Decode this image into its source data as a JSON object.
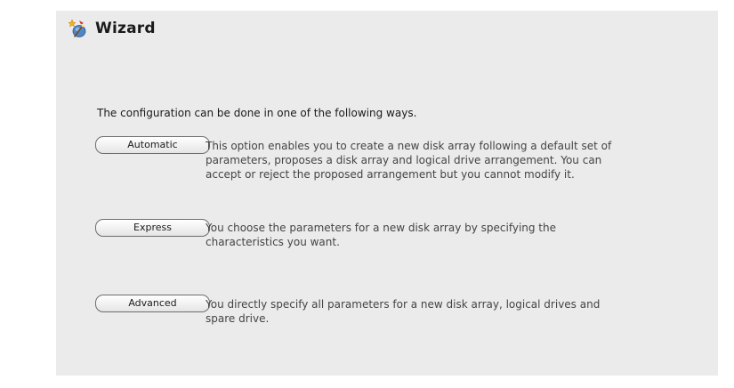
{
  "header": {
    "title": "Wizard",
    "icon": "wizard-icon"
  },
  "intro_text": "The configuration can be done in one of the following ways.",
  "options": [
    {
      "label": "Automatic",
      "description": "This option enables you to create a new disk array following a default set of parameters, proposes a disk array and logical drive arrangement. You can accept or reject the proposed arrangement but you cannot modify it."
    },
    {
      "label": "Express",
      "description": "You choose the parameters for a new disk array by specifying the characteristics you want."
    },
    {
      "label": "Advanced",
      "description": "You directly specify all parameters for a new disk array, logical drives and spare drive."
    }
  ],
  "colors": {
    "panel_background": "#ebebeb",
    "text": "#1a1a1a",
    "description_text": "#444444"
  }
}
